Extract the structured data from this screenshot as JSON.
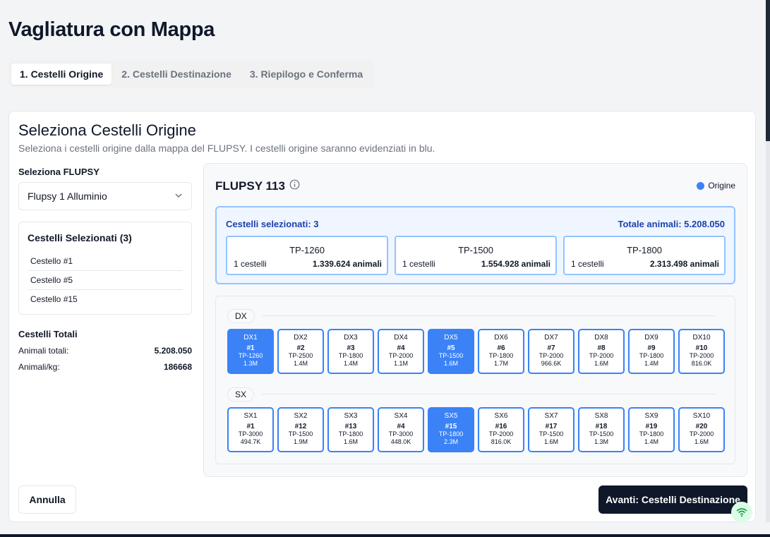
{
  "page": {
    "title": "Vagliatura con Mappa"
  },
  "tabs": [
    {
      "label": "1. Cestelli Origine",
      "active": true
    },
    {
      "label": "2. Cestelli Destinazione",
      "active": false
    },
    {
      "label": "3. Riepilogo e Conferma",
      "active": false
    }
  ],
  "card": {
    "title": "Seleziona Cestelli Origine",
    "subtitle": "Seleziona i cestelli origine dalla mappa del FLUPSY. I cestelli origine saranno evidenziati in blu."
  },
  "left": {
    "flupsy_label": "Seleziona FLUPSY",
    "flupsy_value": "Flupsy 1 Alluminio",
    "selected_title": "Cestelli Selezionati (3)",
    "selected_items": [
      "Cestello #1",
      "Cestello #5",
      "Cestello #15"
    ],
    "totals_title": "Cestelli Totali",
    "totals": [
      {
        "label": "Animali totali:",
        "value": "5.208.050"
      },
      {
        "label": "Animali/kg:",
        "value": "186668"
      }
    ]
  },
  "map": {
    "title": "FLUPSY 113",
    "legend_label": "Origine",
    "summary": {
      "selected_label": "Cestelli selezionati: 3",
      "total_label": "Totale animali: 5.208.050",
      "groups": [
        {
          "size": "TP-1260",
          "count": "1 cestelli",
          "animals": "1.339.624 animali"
        },
        {
          "size": "TP-1500",
          "count": "1 cestelli",
          "animals": "1.554.928 animali"
        },
        {
          "size": "TP-1800",
          "count": "1 cestelli",
          "animals": "2.313.498 animali"
        }
      ]
    },
    "rows": [
      {
        "label": "DX",
        "baskets": [
          {
            "pos": "DX1",
            "num": "#1",
            "size": "TP-1260",
            "qty": "1.3M",
            "selected": true
          },
          {
            "pos": "DX2",
            "num": "#2",
            "size": "TP-2500",
            "qty": "1.4M",
            "selected": false
          },
          {
            "pos": "DX3",
            "num": "#3",
            "size": "TP-1800",
            "qty": "1.4M",
            "selected": false
          },
          {
            "pos": "DX4",
            "num": "#4",
            "size": "TP-2000",
            "qty": "1.1M",
            "selected": false
          },
          {
            "pos": "DX5",
            "num": "#5",
            "size": "TP-1500",
            "qty": "1.6M",
            "selected": true
          },
          {
            "pos": "DX6",
            "num": "#6",
            "size": "TP-1800",
            "qty": "1.7M",
            "selected": false
          },
          {
            "pos": "DX7",
            "num": "#7",
            "size": "TP-2000",
            "qty": "966.6K",
            "selected": false
          },
          {
            "pos": "DX8",
            "num": "#8",
            "size": "TP-2000",
            "qty": "1.6M",
            "selected": false
          },
          {
            "pos": "DX9",
            "num": "#9",
            "size": "TP-1800",
            "qty": "1.4M",
            "selected": false
          },
          {
            "pos": "DX10",
            "num": "#10",
            "size": "TP-2000",
            "qty": "816.0K",
            "selected": false
          }
        ]
      },
      {
        "label": "SX",
        "baskets": [
          {
            "pos": "SX1",
            "num": "#1",
            "size": "TP-3000",
            "qty": "494.7K",
            "selected": false
          },
          {
            "pos": "SX2",
            "num": "#12",
            "size": "TP-1500",
            "qty": "1.9M",
            "selected": false
          },
          {
            "pos": "SX3",
            "num": "#13",
            "size": "TP-1800",
            "qty": "1.6M",
            "selected": false
          },
          {
            "pos": "SX4",
            "num": "#4",
            "size": "TP-3000",
            "qty": "448.0K",
            "selected": false
          },
          {
            "pos": "SX5",
            "num": "#15",
            "size": "TP-1800",
            "qty": "2.3M",
            "selected": true
          },
          {
            "pos": "SX6",
            "num": "#16",
            "size": "TP-2000",
            "qty": "816.0K",
            "selected": false
          },
          {
            "pos": "SX7",
            "num": "#17",
            "size": "TP-1500",
            "qty": "1.6M",
            "selected": false
          },
          {
            "pos": "SX8",
            "num": "#18",
            "size": "TP-1500",
            "qty": "1.3M",
            "selected": false
          },
          {
            "pos": "SX9",
            "num": "#19",
            "size": "TP-1800",
            "qty": "1.4M",
            "selected": false
          },
          {
            "pos": "SX10",
            "num": "#20",
            "size": "TP-2000",
            "qty": "1.6M",
            "selected": false
          }
        ]
      }
    ]
  },
  "actions": {
    "cancel_label": "Annulla",
    "next_label": "Avanti: Cestelli Destinazione"
  },
  "colors": {
    "accent": "#3b82f6",
    "primary_button": "#0f172a"
  }
}
